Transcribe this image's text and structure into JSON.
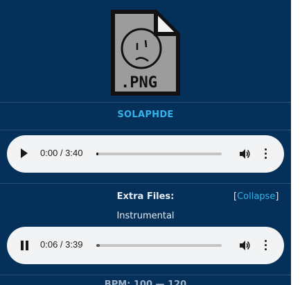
{
  "file": {
    "icon": "png-file-icon",
    "icon_label": ".PNG",
    "title": "SOLAPHDE"
  },
  "players": [
    {
      "state": "paused",
      "time": "0:00 / 3:40",
      "progress": 0.0
    },
    {
      "state": "playing",
      "time": "0:06 / 3:39",
      "progress": 0.03
    }
  ],
  "extra_files": {
    "label": "Extra Files:",
    "collapse_prefix": "[",
    "collapse_link": "Collapse",
    "collapse_suffix": "]",
    "item_label": "Instrumental"
  },
  "bottom_partial_text": "BPM: 100 — 120",
  "colors": {
    "panel_bg": "#04305a",
    "accent": "#36b2ea",
    "player_bg": "#f1f3f4"
  }
}
